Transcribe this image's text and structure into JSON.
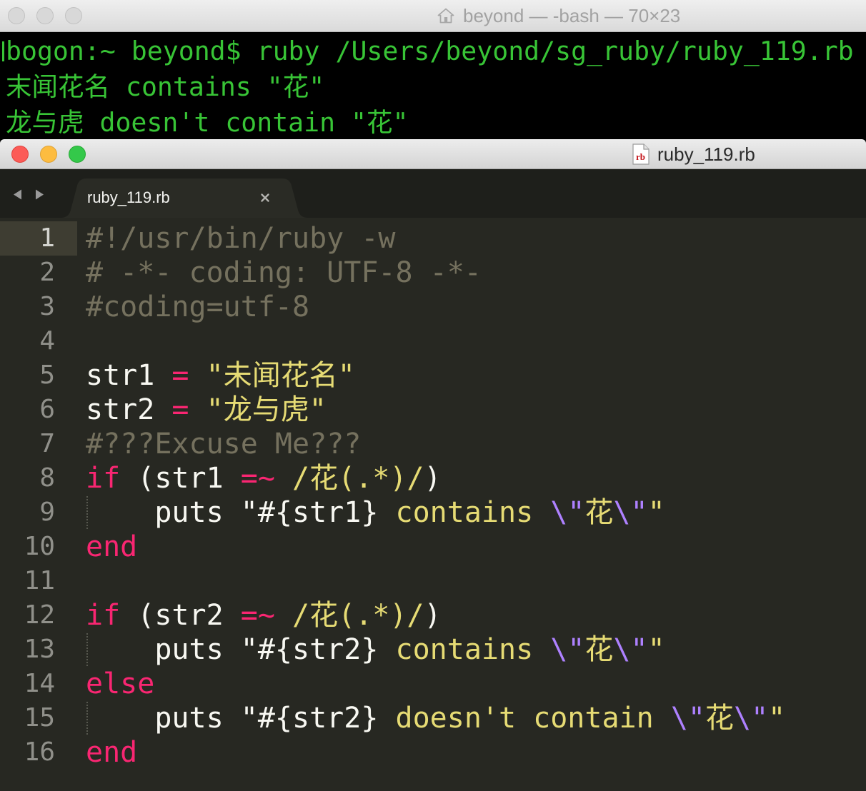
{
  "terminal": {
    "title": "beyond — -bash — 70×23",
    "title_icon": "home-icon",
    "lines": [
      "bogon:~ beyond$ ruby /Users/beyond/sg_ruby/ruby_119.rb",
      "末闻花名 contains \"花\"",
      "龙与虎 doesn't contain \"花\""
    ]
  },
  "editor": {
    "window_title": "ruby_119.rb",
    "file_icon": {
      "icon": "ruby-file-icon",
      "label": "rb"
    },
    "nav_icons": {
      "back": "back-arrow-icon",
      "forward": "forward-arrow-icon"
    },
    "tab": {
      "label": "ruby_119.rb",
      "close_icon": "close-icon"
    },
    "active_line": 1,
    "lines": [
      {
        "n": "1",
        "tokens": [
          [
            "comment",
            "#!/usr/bin/ruby -w"
          ]
        ]
      },
      {
        "n": "2",
        "tokens": [
          [
            "comment",
            "# -*- coding: UTF-8 -*-"
          ]
        ]
      },
      {
        "n": "3",
        "tokens": [
          [
            "comment",
            "#coding=utf-8"
          ]
        ]
      },
      {
        "n": "4",
        "tokens": []
      },
      {
        "n": "5",
        "tokens": [
          [
            "plain",
            "str1 "
          ],
          [
            "keyword",
            "="
          ],
          [
            "plain",
            " "
          ],
          [
            "string",
            "\"未闻花名\""
          ]
        ]
      },
      {
        "n": "6",
        "tokens": [
          [
            "plain",
            "str2 "
          ],
          [
            "keyword",
            "="
          ],
          [
            "plain",
            " "
          ],
          [
            "string",
            "\"龙与虎\""
          ]
        ]
      },
      {
        "n": "7",
        "tokens": [
          [
            "comment",
            "#???Excuse Me???"
          ]
        ]
      },
      {
        "n": "8",
        "tokens": [
          [
            "keyword",
            "if"
          ],
          [
            "plain",
            " (str1 "
          ],
          [
            "keyword",
            "=~"
          ],
          [
            "plain",
            " "
          ],
          [
            "string",
            "/花(.*)/"
          ],
          [
            "plain",
            ")"
          ]
        ]
      },
      {
        "n": "9",
        "tokens": [
          [
            "indent",
            "    "
          ],
          [
            "plain",
            "puts \"#{str1}"
          ],
          [
            "string",
            " contains "
          ],
          [
            "escape",
            "\\\""
          ],
          [
            "string",
            "花"
          ],
          [
            "escape",
            "\\\""
          ],
          [
            "string",
            "\""
          ]
        ]
      },
      {
        "n": "10",
        "tokens": [
          [
            "keyword",
            "end"
          ]
        ]
      },
      {
        "n": "11",
        "tokens": []
      },
      {
        "n": "12",
        "tokens": [
          [
            "keyword",
            "if"
          ],
          [
            "plain",
            " (str2 "
          ],
          [
            "keyword",
            "=~"
          ],
          [
            "plain",
            " "
          ],
          [
            "string",
            "/花(.*)/"
          ],
          [
            "plain",
            ")"
          ]
        ]
      },
      {
        "n": "13",
        "tokens": [
          [
            "indent",
            "    "
          ],
          [
            "plain",
            "puts \"#{str2}"
          ],
          [
            "string",
            " contains "
          ],
          [
            "escape",
            "\\\""
          ],
          [
            "string",
            "花"
          ],
          [
            "escape",
            "\\\""
          ],
          [
            "string",
            "\""
          ]
        ]
      },
      {
        "n": "14",
        "tokens": [
          [
            "keyword",
            "else"
          ]
        ]
      },
      {
        "n": "15",
        "tokens": [
          [
            "indent",
            "    "
          ],
          [
            "plain",
            "puts \"#{str2}"
          ],
          [
            "string",
            " doesn't contain "
          ],
          [
            "escape",
            "\\\""
          ],
          [
            "string",
            "花"
          ],
          [
            "escape",
            "\\\""
          ],
          [
            "string",
            "\""
          ]
        ]
      },
      {
        "n": "16",
        "tokens": [
          [
            "keyword",
            "end"
          ]
        ]
      }
    ]
  },
  "colors": {
    "terminal_text": "#38c436",
    "editor_bg": "#272822",
    "plain": "#f8f8f2",
    "comment": "#75715e",
    "keyword": "#f92672",
    "string": "#e6db74",
    "escape": "#ae81ff",
    "gutter": "#90908a",
    "gutter_active": "#d4d4cf",
    "line_highlight": "#3e3d32",
    "close_button": "#fc5b57",
    "minimize_button": "#fdbc40",
    "zoom_button": "#34c84a"
  }
}
